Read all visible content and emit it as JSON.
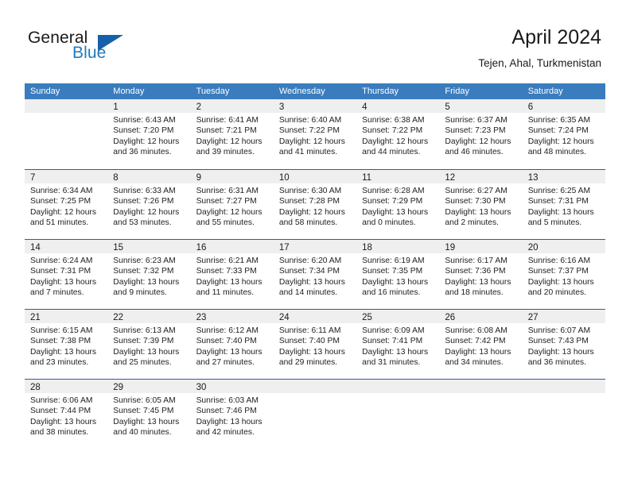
{
  "logo": {
    "word1": "General",
    "word2": "Blue",
    "icon": "triangle-mark",
    "brand_color": "#1560a8"
  },
  "header": {
    "title": "April 2024",
    "location": "Tejen, Ahal, Turkmenistan"
  },
  "theme": {
    "header_blue": "#3a7cbe",
    "separator_blue": "#2a6096",
    "daynum_band": "#efefef"
  },
  "weekday_headers": [
    "Sunday",
    "Monday",
    "Tuesday",
    "Wednesday",
    "Thursday",
    "Friday",
    "Saturday"
  ],
  "weeks": [
    [
      {
        "day": "",
        "sunrise": "",
        "sunset": "",
        "daylight1": "",
        "daylight2": "",
        "state": "empty"
      },
      {
        "day": "1",
        "sunrise": "Sunrise: 6:43 AM",
        "sunset": "Sunset: 7:20 PM",
        "daylight1": "Daylight: 12 hours",
        "daylight2": "and 36 minutes.",
        "state": "filled"
      },
      {
        "day": "2",
        "sunrise": "Sunrise: 6:41 AM",
        "sunset": "Sunset: 7:21 PM",
        "daylight1": "Daylight: 12 hours",
        "daylight2": "and 39 minutes.",
        "state": "filled"
      },
      {
        "day": "3",
        "sunrise": "Sunrise: 6:40 AM",
        "sunset": "Sunset: 7:22 PM",
        "daylight1": "Daylight: 12 hours",
        "daylight2": "and 41 minutes.",
        "state": "filled"
      },
      {
        "day": "4",
        "sunrise": "Sunrise: 6:38 AM",
        "sunset": "Sunset: 7:22 PM",
        "daylight1": "Daylight: 12 hours",
        "daylight2": "and 44 minutes.",
        "state": "filled"
      },
      {
        "day": "5",
        "sunrise": "Sunrise: 6:37 AM",
        "sunset": "Sunset: 7:23 PM",
        "daylight1": "Daylight: 12 hours",
        "daylight2": "and 46 minutes.",
        "state": "filled"
      },
      {
        "day": "6",
        "sunrise": "Sunrise: 6:35 AM",
        "sunset": "Sunset: 7:24 PM",
        "daylight1": "Daylight: 12 hours",
        "daylight2": "and 48 minutes.",
        "state": "filled"
      }
    ],
    [
      {
        "day": "7",
        "sunrise": "Sunrise: 6:34 AM",
        "sunset": "Sunset: 7:25 PM",
        "daylight1": "Daylight: 12 hours",
        "daylight2": "and 51 minutes.",
        "state": "filled"
      },
      {
        "day": "8",
        "sunrise": "Sunrise: 6:33 AM",
        "sunset": "Sunset: 7:26 PM",
        "daylight1": "Daylight: 12 hours",
        "daylight2": "and 53 minutes.",
        "state": "filled"
      },
      {
        "day": "9",
        "sunrise": "Sunrise: 6:31 AM",
        "sunset": "Sunset: 7:27 PM",
        "daylight1": "Daylight: 12 hours",
        "daylight2": "and 55 minutes.",
        "state": "filled"
      },
      {
        "day": "10",
        "sunrise": "Sunrise: 6:30 AM",
        "sunset": "Sunset: 7:28 PM",
        "daylight1": "Daylight: 12 hours",
        "daylight2": "and 58 minutes.",
        "state": "filled"
      },
      {
        "day": "11",
        "sunrise": "Sunrise: 6:28 AM",
        "sunset": "Sunset: 7:29 PM",
        "daylight1": "Daylight: 13 hours",
        "daylight2": "and 0 minutes.",
        "state": "filled"
      },
      {
        "day": "12",
        "sunrise": "Sunrise: 6:27 AM",
        "sunset": "Sunset: 7:30 PM",
        "daylight1": "Daylight: 13 hours",
        "daylight2": "and 2 minutes.",
        "state": "filled"
      },
      {
        "day": "13",
        "sunrise": "Sunrise: 6:25 AM",
        "sunset": "Sunset: 7:31 PM",
        "daylight1": "Daylight: 13 hours",
        "daylight2": "and 5 minutes.",
        "state": "filled"
      }
    ],
    [
      {
        "day": "14",
        "sunrise": "Sunrise: 6:24 AM",
        "sunset": "Sunset: 7:31 PM",
        "daylight1": "Daylight: 13 hours",
        "daylight2": "and 7 minutes.",
        "state": "filled"
      },
      {
        "day": "15",
        "sunrise": "Sunrise: 6:23 AM",
        "sunset": "Sunset: 7:32 PM",
        "daylight1": "Daylight: 13 hours",
        "daylight2": "and 9 minutes.",
        "state": "filled"
      },
      {
        "day": "16",
        "sunrise": "Sunrise: 6:21 AM",
        "sunset": "Sunset: 7:33 PM",
        "daylight1": "Daylight: 13 hours",
        "daylight2": "and 11 minutes.",
        "state": "filled"
      },
      {
        "day": "17",
        "sunrise": "Sunrise: 6:20 AM",
        "sunset": "Sunset: 7:34 PM",
        "daylight1": "Daylight: 13 hours",
        "daylight2": "and 14 minutes.",
        "state": "filled"
      },
      {
        "day": "18",
        "sunrise": "Sunrise: 6:19 AM",
        "sunset": "Sunset: 7:35 PM",
        "daylight1": "Daylight: 13 hours",
        "daylight2": "and 16 minutes.",
        "state": "filled"
      },
      {
        "day": "19",
        "sunrise": "Sunrise: 6:17 AM",
        "sunset": "Sunset: 7:36 PM",
        "daylight1": "Daylight: 13 hours",
        "daylight2": "and 18 minutes.",
        "state": "filled"
      },
      {
        "day": "20",
        "sunrise": "Sunrise: 6:16 AM",
        "sunset": "Sunset: 7:37 PM",
        "daylight1": "Daylight: 13 hours",
        "daylight2": "and 20 minutes.",
        "state": "filled"
      }
    ],
    [
      {
        "day": "21",
        "sunrise": "Sunrise: 6:15 AM",
        "sunset": "Sunset: 7:38 PM",
        "daylight1": "Daylight: 13 hours",
        "daylight2": "and 23 minutes.",
        "state": "filled"
      },
      {
        "day": "22",
        "sunrise": "Sunrise: 6:13 AM",
        "sunset": "Sunset: 7:39 PM",
        "daylight1": "Daylight: 13 hours",
        "daylight2": "and 25 minutes.",
        "state": "filled"
      },
      {
        "day": "23",
        "sunrise": "Sunrise: 6:12 AM",
        "sunset": "Sunset: 7:40 PM",
        "daylight1": "Daylight: 13 hours",
        "daylight2": "and 27 minutes.",
        "state": "filled"
      },
      {
        "day": "24",
        "sunrise": "Sunrise: 6:11 AM",
        "sunset": "Sunset: 7:40 PM",
        "daylight1": "Daylight: 13 hours",
        "daylight2": "and 29 minutes.",
        "state": "filled"
      },
      {
        "day": "25",
        "sunrise": "Sunrise: 6:09 AM",
        "sunset": "Sunset: 7:41 PM",
        "daylight1": "Daylight: 13 hours",
        "daylight2": "and 31 minutes.",
        "state": "filled"
      },
      {
        "day": "26",
        "sunrise": "Sunrise: 6:08 AM",
        "sunset": "Sunset: 7:42 PM",
        "daylight1": "Daylight: 13 hours",
        "daylight2": "and 34 minutes.",
        "state": "filled"
      },
      {
        "day": "27",
        "sunrise": "Sunrise: 6:07 AM",
        "sunset": "Sunset: 7:43 PM",
        "daylight1": "Daylight: 13 hours",
        "daylight2": "and 36 minutes.",
        "state": "filled"
      }
    ],
    [
      {
        "day": "28",
        "sunrise": "Sunrise: 6:06 AM",
        "sunset": "Sunset: 7:44 PM",
        "daylight1": "Daylight: 13 hours",
        "daylight2": "and 38 minutes.",
        "state": "filled"
      },
      {
        "day": "29",
        "sunrise": "Sunrise: 6:05 AM",
        "sunset": "Sunset: 7:45 PM",
        "daylight1": "Daylight: 13 hours",
        "daylight2": "and 40 minutes.",
        "state": "filled"
      },
      {
        "day": "30",
        "sunrise": "Sunrise: 6:03 AM",
        "sunset": "Sunset: 7:46 PM",
        "daylight1": "Daylight: 13 hours",
        "daylight2": "and 42 minutes.",
        "state": "filled"
      },
      {
        "day": "",
        "sunrise": "",
        "sunset": "",
        "daylight1": "",
        "daylight2": "",
        "state": "empty"
      },
      {
        "day": "",
        "sunrise": "",
        "sunset": "",
        "daylight1": "",
        "daylight2": "",
        "state": "empty"
      },
      {
        "day": "",
        "sunrise": "",
        "sunset": "",
        "daylight1": "",
        "daylight2": "",
        "state": "empty"
      },
      {
        "day": "",
        "sunrise": "",
        "sunset": "",
        "daylight1": "",
        "daylight2": "",
        "state": "empty"
      }
    ]
  ]
}
